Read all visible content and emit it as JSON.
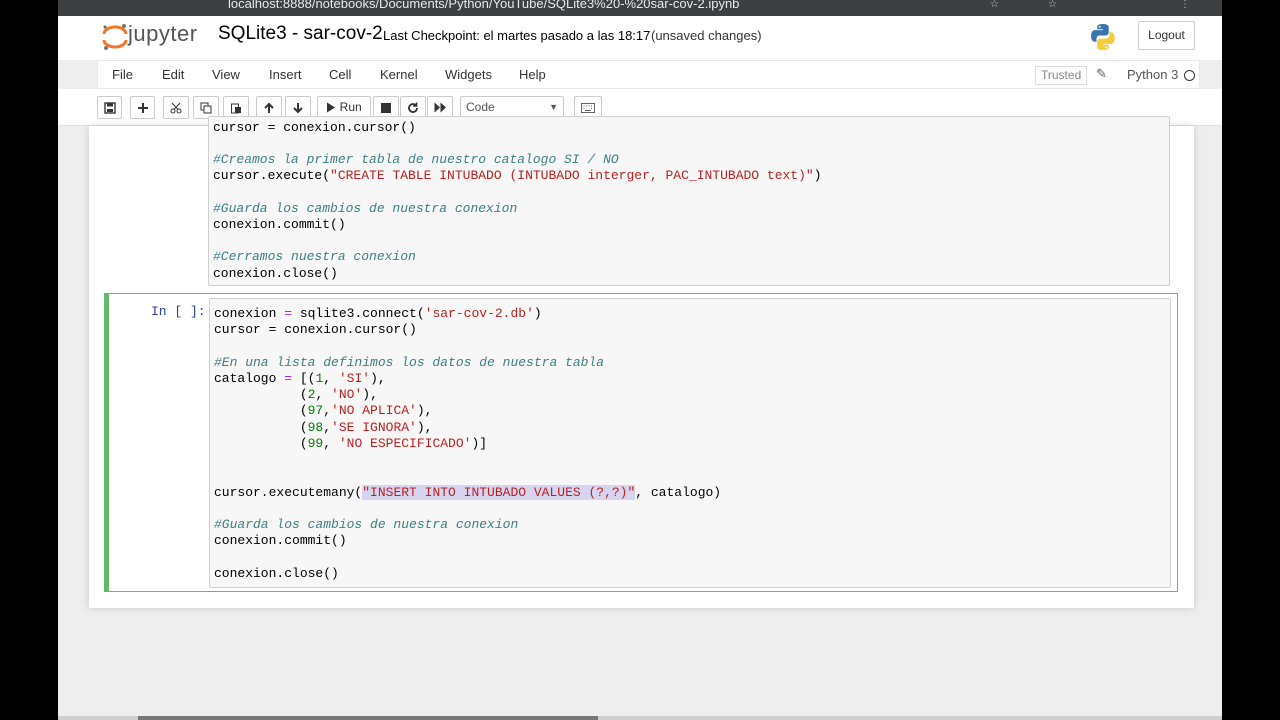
{
  "browser": {
    "url": "localhost:8888/notebooks/Documents/Python/YouTube/SQLite3%20-%20sar-cov-2.ipynb"
  },
  "header": {
    "logo_text": "jupyter",
    "notebook_name": "SQLite3 - sar-cov-2",
    "checkpoint": "Last Checkpoint: el martes pasado a las 18:17",
    "autosave": "(unsaved changes)",
    "logout_label": "Logout"
  },
  "menu": {
    "items": [
      "File",
      "Edit",
      "View",
      "Insert",
      "Cell",
      "Kernel",
      "Widgets",
      "Help"
    ],
    "trusted": "Trusted",
    "kernel": "Python 3"
  },
  "toolbar": {
    "run_label": "Run",
    "cell_type": "Code",
    "icons": [
      "save-icon",
      "plus-icon",
      "cut-icon",
      "copy-icon",
      "paste-icon",
      "arrow-up-icon",
      "arrow-down-icon",
      "play-icon",
      "stop-icon",
      "restart-icon",
      "fast-forward-icon",
      "keyboard-icon"
    ]
  },
  "cell1": {
    "lines": [
      "cursor = conexion.cursor()",
      "",
      "#Creamos la primer tabla de nuestro catalogo SI / NO",
      "cursor.execute(\"CREATE TABLE INTUBADO (INTUBADO interger, PAC_INTUBADO text)\")",
      "",
      "#Guarda los cambios de nuestra conexion",
      "conexion.commit()",
      "",
      "#Cerramos nuestra conexion",
      "conexion.close()"
    ]
  },
  "cell2": {
    "prompt": "In [ ]:",
    "lines": [
      "conexion = sqlite3.connect('sar-cov-2.db')",
      "cursor = conexion.cursor()",
      "",
      "#En una lista definimos los datos de nuestra tabla",
      "catalogo = [(1, 'SI'),",
      "           (2, 'NO'),",
      "           (97,'NO APLICA'),",
      "           (98,'SE IGNORA'),",
      "           (99, 'NO ESPECIFICADO')]",
      "",
      "",
      "cursor.executemany(\"INSERT INTO INTUBADO VALUES (?,?)\", catalogo)",
      "",
      "#Guarda los cambios de nuestra conexion",
      "conexion.commit()",
      "",
      "conexion.close()"
    ]
  },
  "colors": {
    "active_cell_border": "#66bb6a",
    "prompt": "#303f9f",
    "comment": "#408080",
    "string": "#ba2121"
  }
}
